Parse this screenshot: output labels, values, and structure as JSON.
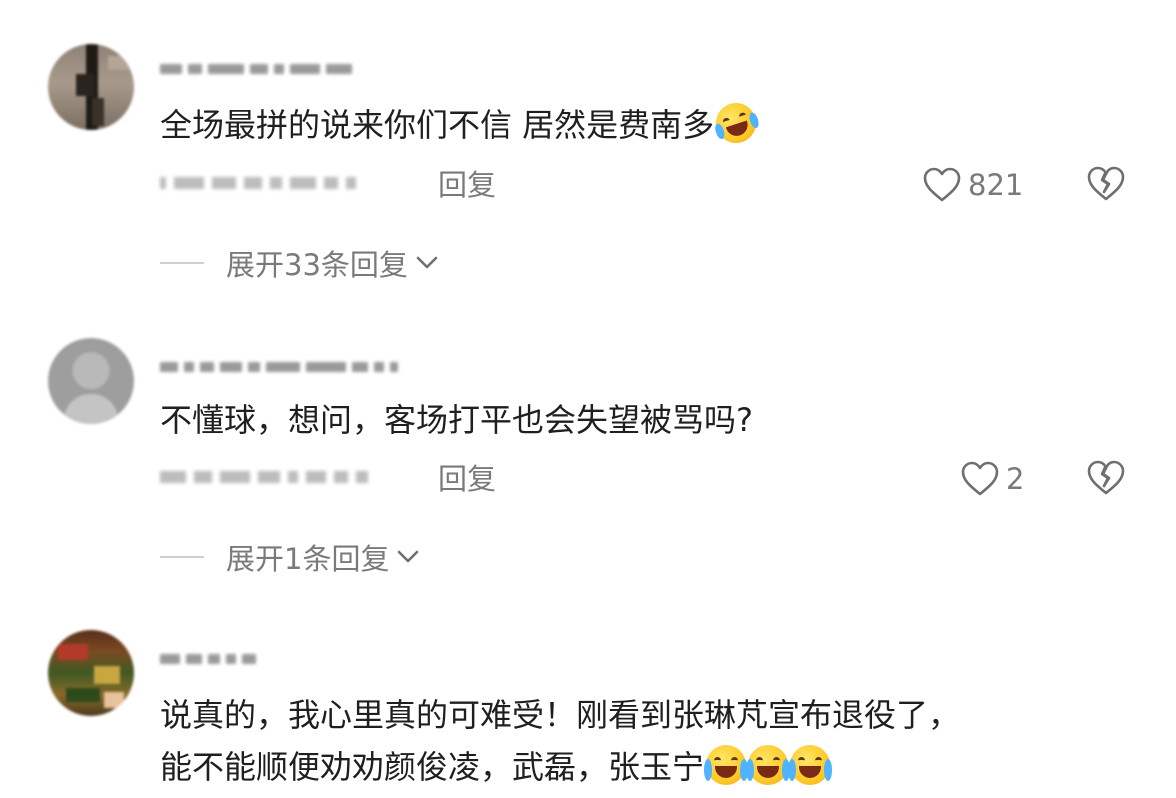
{
  "comments": [
    {
      "text": "全场最拼的说来你们不信  居然是费南多",
      "emojis": [
        "rolling-on-floor-laughing-emoji"
      ],
      "reply_label": "回复",
      "like_count": "821",
      "expand_label": "展开33条回复"
    },
    {
      "text": "不懂球，想问，客场打平也会失望被骂吗?",
      "reply_label": "回复",
      "like_count": "2",
      "expand_label": "展开1条回复"
    },
    {
      "text_line1": "说真的，我心里真的可难受！刚看到张琳芃宣布退役了，",
      "text_line2": "能不能顺便劝劝颜俊凌，武磊，张玉宁",
      "emojis": [
        "loudly-crying-emoji",
        "loudly-crying-emoji",
        "loudly-crying-emoji"
      ]
    }
  ],
  "icons": {
    "like": "heart-outline-icon",
    "dislike": "broken-heart-icon",
    "expand": "chevron-down-icon"
  },
  "colors": {
    "text": "#1f1f1f",
    "secondary": "#7a7a7a",
    "divider": "#cfcfcf"
  }
}
